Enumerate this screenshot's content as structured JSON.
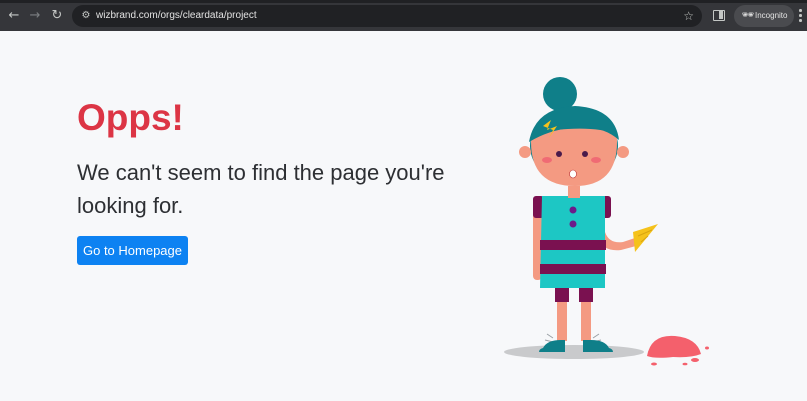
{
  "browser": {
    "back_icon": "arrow-left-icon",
    "forward_icon": "arrow-right-icon",
    "reload_icon": "reload-icon",
    "site_info_icon": "tune-icon",
    "url": "wizbrand.com/orgs/cleardata/project",
    "bookmark_icon": "star-icon",
    "side_panel_icon": "side-panel-icon",
    "incognito_label": "Incognito",
    "menu_icon": "more-vert-icon"
  },
  "page": {
    "heading": "Opps!",
    "message": "We can't seem to find the page you're looking for.",
    "home_button_label": "Go to Homepage"
  },
  "colors": {
    "heading": "#dc3545",
    "button": "#0d82f2",
    "background": "#f7f8fa",
    "chrome": "#35363a"
  }
}
